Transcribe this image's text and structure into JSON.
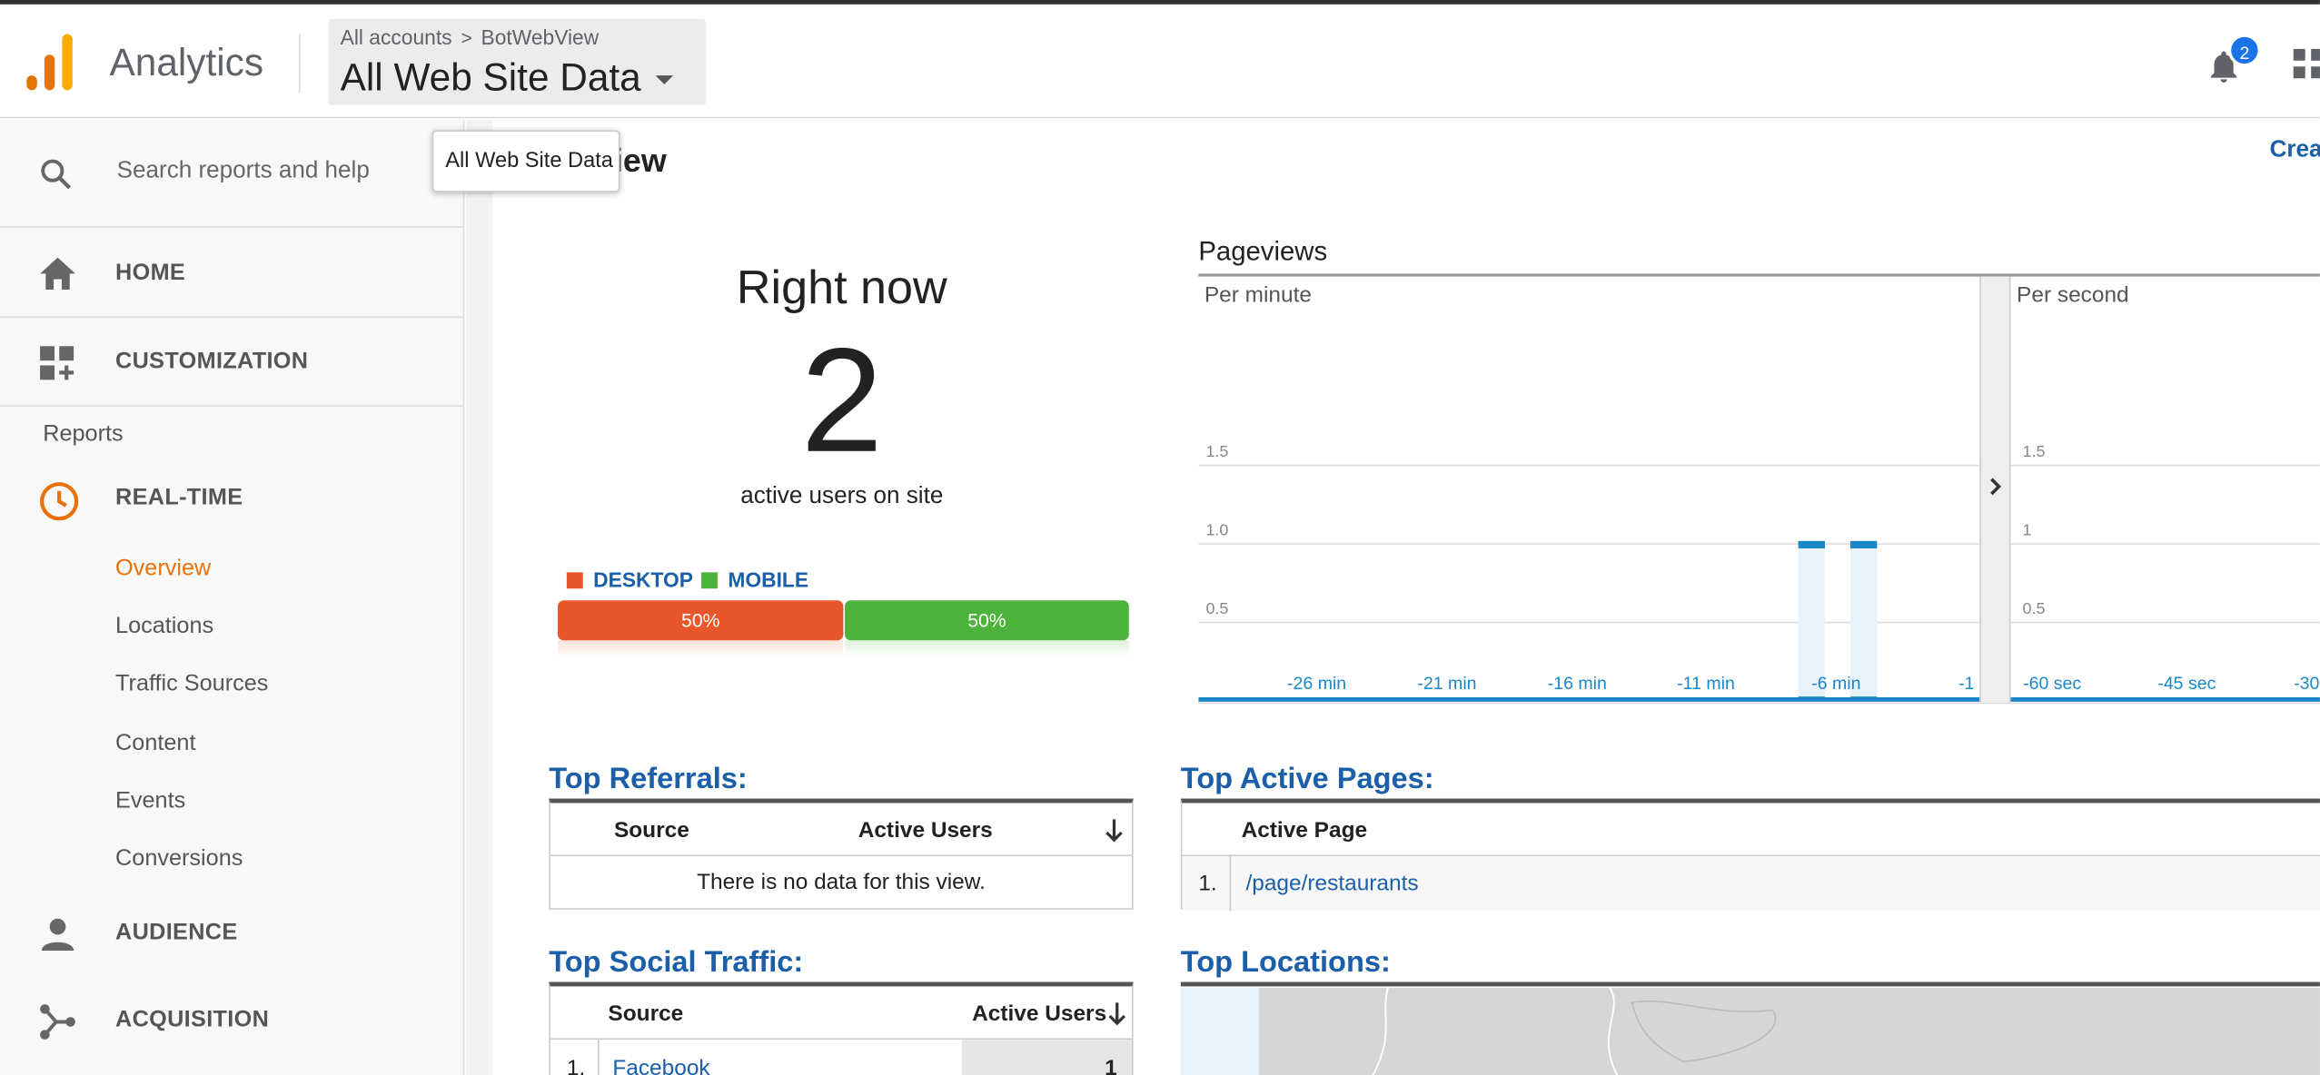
{
  "header": {
    "app_name": "Analytics",
    "breadcrumb_root": "All accounts",
    "breadcrumb_property": "BotWebView",
    "view_name": "All Web Site Data",
    "notification_count": "2",
    "logo_colors": [
      "#e8710a",
      "#f9ab00",
      "#e37400"
    ]
  },
  "tooltip": {
    "text": "All Web Site Data"
  },
  "page": {
    "title_visible": "iew",
    "create_link": "Crea"
  },
  "sidebar": {
    "search_placeholder": "Search reports and help",
    "home": "HOME",
    "customization": "CUSTOMIZATION",
    "reports_header": "Reports",
    "realtime": "REAL-TIME",
    "realtime_items": [
      {
        "label": "Overview",
        "active": true
      },
      {
        "label": "Locations"
      },
      {
        "label": "Traffic Sources"
      },
      {
        "label": "Content"
      },
      {
        "label": "Events"
      },
      {
        "label": "Conversions"
      }
    ],
    "audience": "AUDIENCE",
    "acquisition": "ACQUISITION",
    "accent": "#e8710a"
  },
  "right_now": {
    "title": "Right now",
    "count": "2",
    "subtitle": "active users on site",
    "legend": {
      "desktop": "DESKTOP",
      "mobile": "MOBILE"
    },
    "desktop_pct_label": "50%",
    "mobile_pct_label": "50%",
    "desktop_share": 0.5,
    "colors": {
      "desktop": "#e8572b",
      "mobile": "#4db33d"
    }
  },
  "pageviews": {
    "title": "Pageviews",
    "per_minute_label": "Per minute",
    "per_second_label": "Per second"
  },
  "chart_data": [
    {
      "type": "bar",
      "title": "Per minute",
      "x_tick_labels": [
        "-26 min",
        "-21 min",
        "-16 min",
        "-11 min",
        "-6 min",
        "-1"
      ],
      "y_tick_labels": [
        "0.5",
        "1.0",
        "1.5"
      ],
      "ylim": [
        0,
        2
      ],
      "bars": [
        {
          "x": -7,
          "value": 1
        },
        {
          "x": -5,
          "value": 1
        }
      ],
      "bar_color": "#1a87c9",
      "grid": true
    },
    {
      "type": "bar",
      "title": "Per second",
      "x_tick_labels": [
        "-60 sec",
        "-45 sec",
        "-30"
      ],
      "y_tick_labels": [
        "0.5",
        "1",
        "1.5"
      ],
      "ylim": [
        0,
        2
      ],
      "bars": [],
      "grid": true
    }
  ],
  "top_referrals": {
    "title": "Top Referrals:",
    "col_source": "Source",
    "col_users": "Active Users",
    "empty_message": "There is no data for this view."
  },
  "top_active_pages": {
    "title": "Top Active Pages:",
    "col_page": "Active Page",
    "rows": [
      {
        "index": "1.",
        "page": "/page/restaurants"
      }
    ]
  },
  "top_social": {
    "title": "Top Social Traffic:",
    "col_source": "Source",
    "col_users": "Active Users",
    "rows": [
      {
        "index": "1.",
        "source": "Facebook",
        "users": "1"
      }
    ]
  },
  "top_locations": {
    "title": "Top Locations:"
  }
}
